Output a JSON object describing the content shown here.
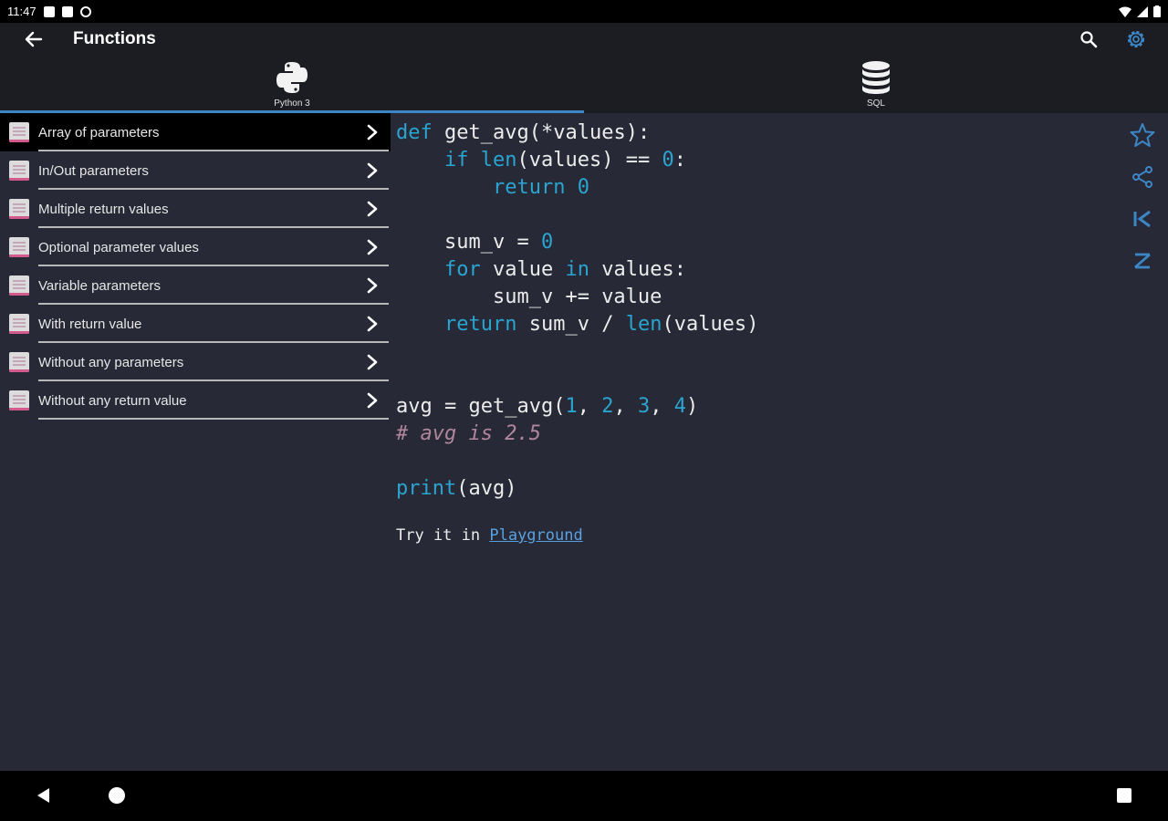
{
  "status_bar": {
    "time": "11:47"
  },
  "app_bar": {
    "title": "Functions"
  },
  "tabs": [
    {
      "label": "Python 3",
      "icon": "python-logo-icon",
      "active": true
    },
    {
      "label": "SQL",
      "icon": "database-icon",
      "active": false
    }
  ],
  "sidebar": {
    "items": [
      {
        "label": "Array of parameters",
        "active": true
      },
      {
        "label": "In/Out parameters"
      },
      {
        "label": "Multiple return values"
      },
      {
        "label": "Optional parameter values"
      },
      {
        "label": "Variable parameters"
      },
      {
        "label": "With return value"
      },
      {
        "label": "Without any parameters"
      },
      {
        "label": "Without any return value"
      }
    ]
  },
  "code": {
    "lines": [
      "def get_avg(*values):",
      "    if len(values) == 0:",
      "        return 0",
      "",
      "    sum_v = 0",
      "    for value in values:",
      "        sum_v += value",
      "    return sum_v / len(values)",
      "",
      "",
      "avg = get_avg(1, 2, 3, 4)",
      "# avg is 2.5",
      "",
      "print(avg)"
    ]
  },
  "try_it": {
    "prefix": "Try it in ",
    "link": "Playground"
  },
  "colors": {
    "accent": "#3d86c6",
    "keyword": "#2aa4d0",
    "comment": "#b0869c",
    "background": "#272a36"
  }
}
